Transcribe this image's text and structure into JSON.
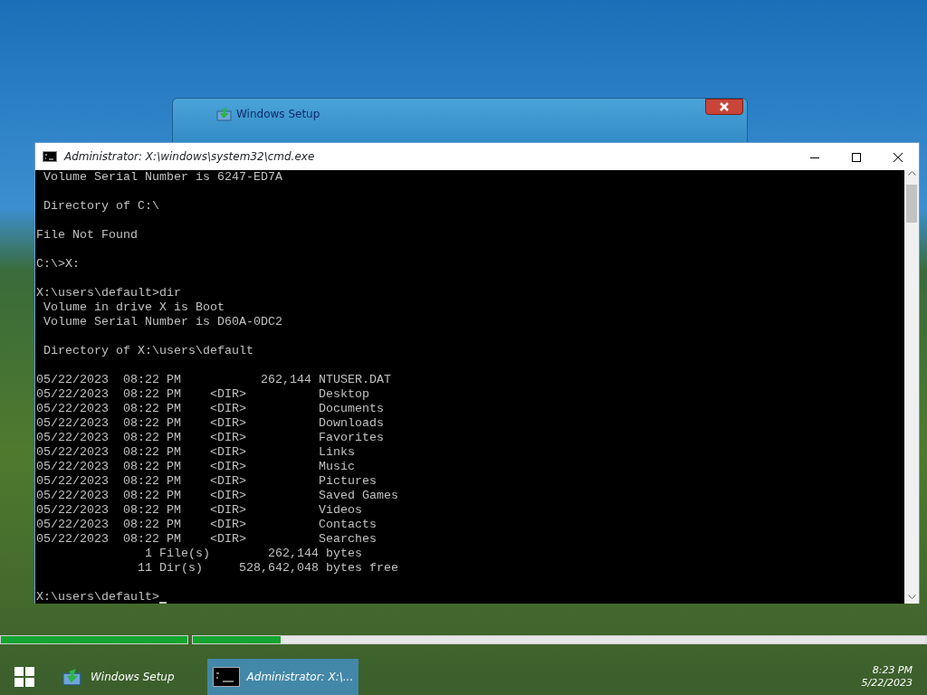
{
  "setup_window": {
    "title": "Windows Setup"
  },
  "console_window": {
    "title": "Administrator: X:\\windows\\system32\\cmd.exe",
    "lines": [
      {
        "kind": "text",
        "text": " Volume Serial Number is 6247-ED7A"
      },
      {
        "kind": "blank"
      },
      {
        "kind": "text",
        "text": " Directory of C:\\"
      },
      {
        "kind": "blank"
      },
      {
        "kind": "text",
        "text": "File Not Found"
      },
      {
        "kind": "blank"
      },
      {
        "kind": "text",
        "text": "C:\\>X:"
      },
      {
        "kind": "blank"
      },
      {
        "kind": "text",
        "text": "X:\\users\\default>dir"
      },
      {
        "kind": "text",
        "text": " Volume in drive X is Boot"
      },
      {
        "kind": "text",
        "text": " Volume Serial Number is D60A-0DC2"
      },
      {
        "kind": "blank"
      },
      {
        "kind": "text",
        "text": " Directory of X:\\users\\default"
      },
      {
        "kind": "blank"
      },
      {
        "kind": "text",
        "text": "05/22/2023  08:22 PM           262,144 NTUSER.DAT"
      },
      {
        "kind": "text",
        "text": "05/22/2023  08:22 PM    <DIR>          Desktop"
      },
      {
        "kind": "text",
        "text": "05/22/2023  08:22 PM    <DIR>          Documents"
      },
      {
        "kind": "text",
        "text": "05/22/2023  08:22 PM    <DIR>          Downloads"
      },
      {
        "kind": "text",
        "text": "05/22/2023  08:22 PM    <DIR>          Favorites"
      },
      {
        "kind": "text",
        "text": "05/22/2023  08:22 PM    <DIR>          Links"
      },
      {
        "kind": "text",
        "text": "05/22/2023  08:22 PM    <DIR>          Music"
      },
      {
        "kind": "text",
        "text": "05/22/2023  08:22 PM    <DIR>          Pictures"
      },
      {
        "kind": "text",
        "text": "05/22/2023  08:22 PM    <DIR>          Saved Games"
      },
      {
        "kind": "text",
        "text": "05/22/2023  08:22 PM    <DIR>          Videos"
      },
      {
        "kind": "text",
        "text": "05/22/2023  08:22 PM    <DIR>          Contacts"
      },
      {
        "kind": "text",
        "text": "05/22/2023  08:22 PM    <DIR>          Searches"
      },
      {
        "kind": "text",
        "text": "               1 File(s)        262,144 bytes"
      },
      {
        "kind": "text",
        "text": "              11 Dir(s)     528,642,048 bytes free"
      },
      {
        "kind": "blank"
      },
      {
        "kind": "prompt",
        "text": "X:\\users\\default>"
      }
    ]
  },
  "setup_progress": [
    {
      "level": 1.0
    },
    {
      "level": 0.12
    }
  ],
  "taskbar": {
    "apps": [
      {
        "label": "Windows Setup",
        "selected": false,
        "kind": "setup"
      },
      {
        "label": "Administrator: X:\\...",
        "selected": true,
        "kind": "console"
      }
    ],
    "time": "8:23 PM",
    "date": "5/22/2023"
  }
}
